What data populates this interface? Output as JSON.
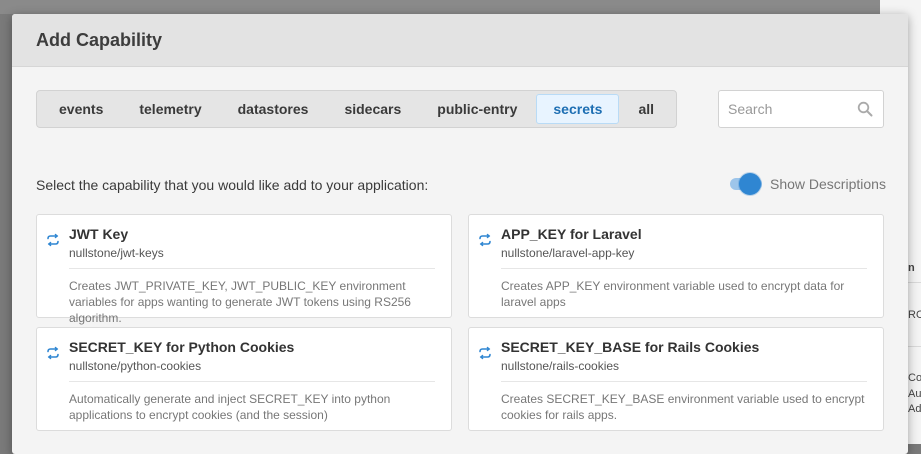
{
  "modal": {
    "title": "Add Capability",
    "tabs": [
      {
        "label": "events",
        "active": false
      },
      {
        "label": "telemetry",
        "active": false
      },
      {
        "label": "datastores",
        "active": false
      },
      {
        "label": "sidecars",
        "active": false
      },
      {
        "label": "public-entry",
        "active": false
      },
      {
        "label": "secrets",
        "active": true
      },
      {
        "label": "all",
        "active": false
      }
    ],
    "search": {
      "placeholder": "Search",
      "value": ""
    },
    "instructions": "Select the capability that you would like add to your application:",
    "toggle": {
      "label": "Show Descriptions",
      "on": true
    },
    "cards": [
      {
        "icon": "link-icon",
        "title": "JWT Key",
        "module": "nullstone/jwt-keys",
        "description": "Creates JWT_PRIVATE_KEY, JWT_PUBLIC_KEY environment variables for apps wanting to generate JWT tokens using RS256 algorithm."
      },
      {
        "icon": "link-icon",
        "title": "APP_KEY for Laravel",
        "module": "nullstone/laravel-app-key",
        "description": "Creates APP_KEY environment variable used to encrypt data for laravel apps"
      },
      {
        "icon": "link-icon",
        "title": "SECRET_KEY for Python Cookies",
        "module": "nullstone/python-cookies",
        "description": "Automatically generate and inject SECRET_KEY into python applications to encrypt cookies (and the session)"
      },
      {
        "icon": "link-icon",
        "title": "SECRET_KEY_BASE for Rails Cookies",
        "module": "nullstone/rails-cookies",
        "description": "Creates SECRET_KEY_BASE environment variable used to encrypt cookies for rails apps."
      }
    ]
  },
  "backdrop": {
    "fragments": [
      "n",
      "RO",
      "Co",
      "Au",
      "Ad"
    ]
  },
  "colors": {
    "accent": "#2f86d2",
    "active_tab_bg": "#e8f4ff",
    "active_tab_text": "#1e6fb3",
    "overlay": "#7a7a7a"
  }
}
